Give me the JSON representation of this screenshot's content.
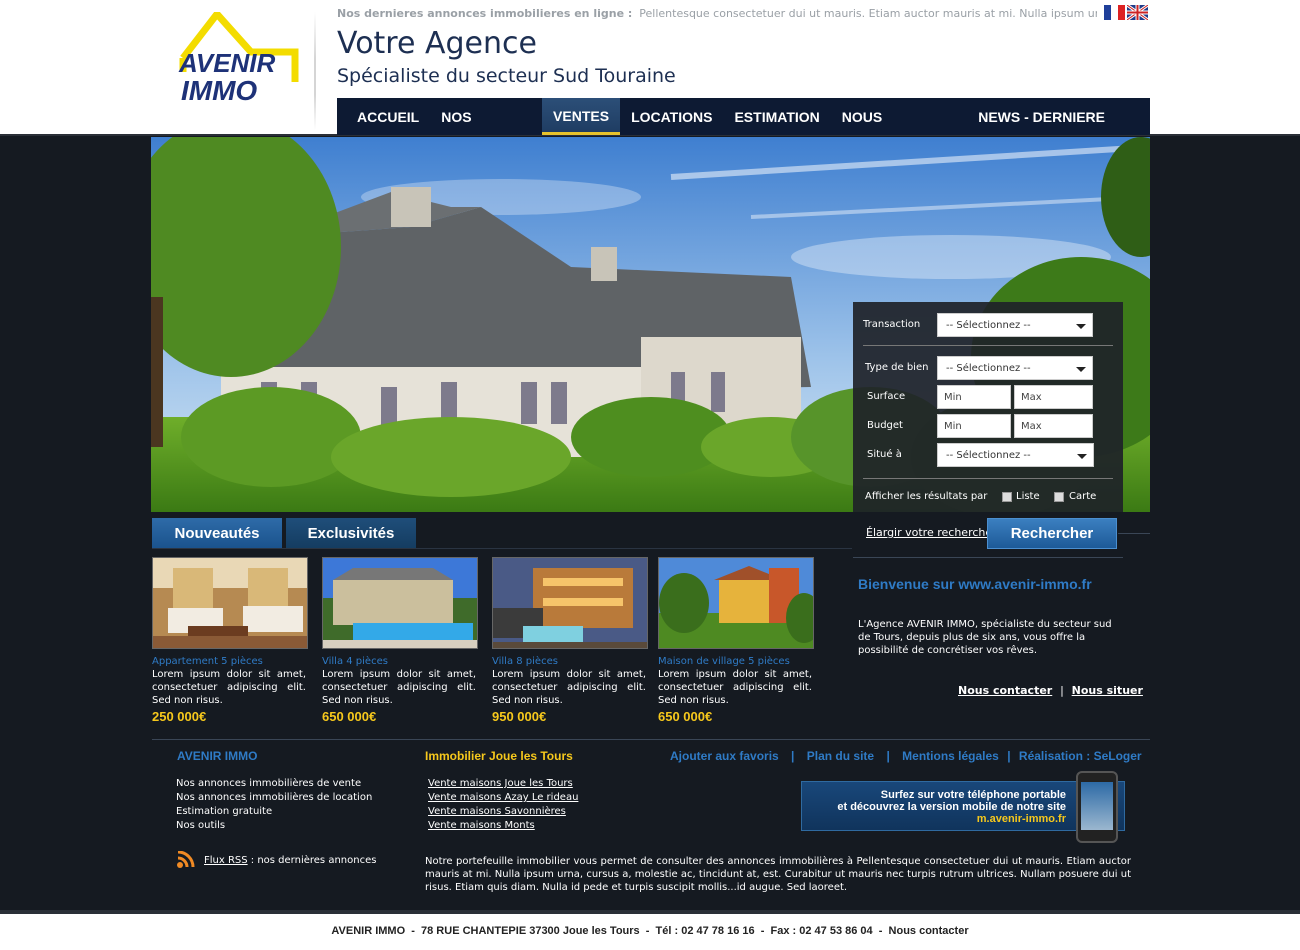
{
  "header": {
    "logo_line1": "AVENIR",
    "logo_line2": "IMMO",
    "ticker_label": "Nos dernieres annonces immobilieres en ligne :",
    "ticker_text": "Pellentesque consectetuer dui ut mauris. Etiam auctor mauris at mi. Nulla ipsum urna, cursus abvfzd...",
    "title": "Votre Agence",
    "subtitle": "Spécialiste du secteur Sud Touraine"
  },
  "nav": {
    "items": [
      {
        "label": "ACCUEIL"
      },
      {
        "label": "NOS AGENCES"
      },
      {
        "label": "VENTES"
      },
      {
        "label": "LOCATIONS"
      },
      {
        "label": "ESTIMATION"
      },
      {
        "label": "NOUS CONTACTER"
      },
      {
        "label": "NEWS - DERNIERE MINUTE"
      }
    ],
    "active_index": 2
  },
  "search": {
    "transaction_label": "Transaction",
    "transaction_value": "-- Sélectionnez --",
    "type_label": "Type de bien",
    "type_value": "-- Sélectionnez --",
    "surface_label": "Surface",
    "surface_min": "Min",
    "surface_max": "Max",
    "budget_label": "Budget",
    "budget_min": "Min",
    "budget_max": "Max",
    "situe_label": "Situé à",
    "situe_value": "-- Sélectionnez --",
    "results_label": "Afficher les résultats par",
    "opt_liste": "Liste",
    "opt_carte": "Carte",
    "elargir": "Élargir votre recherche",
    "button": "Rechercher"
  },
  "tabs": {
    "new": "Nouveautés",
    "exclusive": "Exclusivités"
  },
  "listings": [
    {
      "title": "Appartement 5 pièces",
      "desc": "Lorem ipsum dolor sit amet, consectetuer adipiscing elit. Sed non risus.",
      "price": "250 000€"
    },
    {
      "title": "Villa 4 pièces",
      "desc": "Lorem ipsum dolor sit amet, consectetuer adipiscing elit. Sed non risus.",
      "price": "650 000€"
    },
    {
      "title": "Villa 8 pièces",
      "desc": "Lorem ipsum dolor sit amet, consectetuer adipiscing elit. Sed non risus.",
      "price": "950 000€"
    },
    {
      "title": "Maison de village 5 pièces",
      "desc": "Lorem ipsum dolor sit amet, consectetuer adipiscing elit. Sed non risus.",
      "price": "650 000€"
    }
  ],
  "welcome": {
    "title": "Bienvenue sur www.avenir-immo.fr",
    "text": "L'Agence AVENIR IMMO, spécialiste du secteur sud de Tours, depuis plus de six ans, vous offre la possibilité de concrétiser vos rêves.",
    "link_contact": "Nous contacter",
    "separator": "|",
    "link_situer": "Nous situer"
  },
  "footer": {
    "col1_title": "AVENIR IMMO",
    "col1_items": [
      "Nos annonces immobilières de vente",
      "Nos annonces immobilières de location",
      "Estimation gratuite",
      "Nos outils"
    ],
    "col2_title": "Immobilier Joue les Tours",
    "col2_items": [
      "Vente maisons Joue les Tours",
      "Vente maisons Azay Le rideau",
      "Vente maisons Savonnières",
      "Vente maisons Monts"
    ],
    "links": [
      "Ajouter aux favoris",
      "Plan du site",
      "Mentions légales",
      "Réalisation : SeLoger"
    ],
    "mobile_line1": "Surfez sur votre téléphone portable",
    "mobile_line2": "et découvrez la version mobile de notre site",
    "mobile_url": "m.avenir-immo.fr",
    "rss_link": "Flux RSS",
    "rss_text": " : nos dernières annonces",
    "paragraph": "Notre portefeuille immobilier vous permet de consulter des annonces immobilières à Pellentesque consectetuer dui ut mauris. Etiam auctor mauris at mi. Nulla ipsum urna, cursus a, molestie ac, tincidunt at, est. Curabitur ut mauris nec turpis rutrum ultrices. Nullam posuere dui ut risus. Etiam quis diam. Nulla id pede et turpis suscipit mollis...id augue. Sed laoreet.",
    "bottom": "AVENIR IMMO  -  78 RUE CHANTEPIE 37300 Joue les Tours  -  Tél : 02 47 78 16 16  -  Fax : 02 47 53 86 04  -  Nous contacter"
  },
  "colors": {
    "navy": "#0d1a33",
    "accent_blue": "#2f7bc6",
    "price_yellow": "#f6c81c",
    "dark_bg": "#151a21"
  }
}
